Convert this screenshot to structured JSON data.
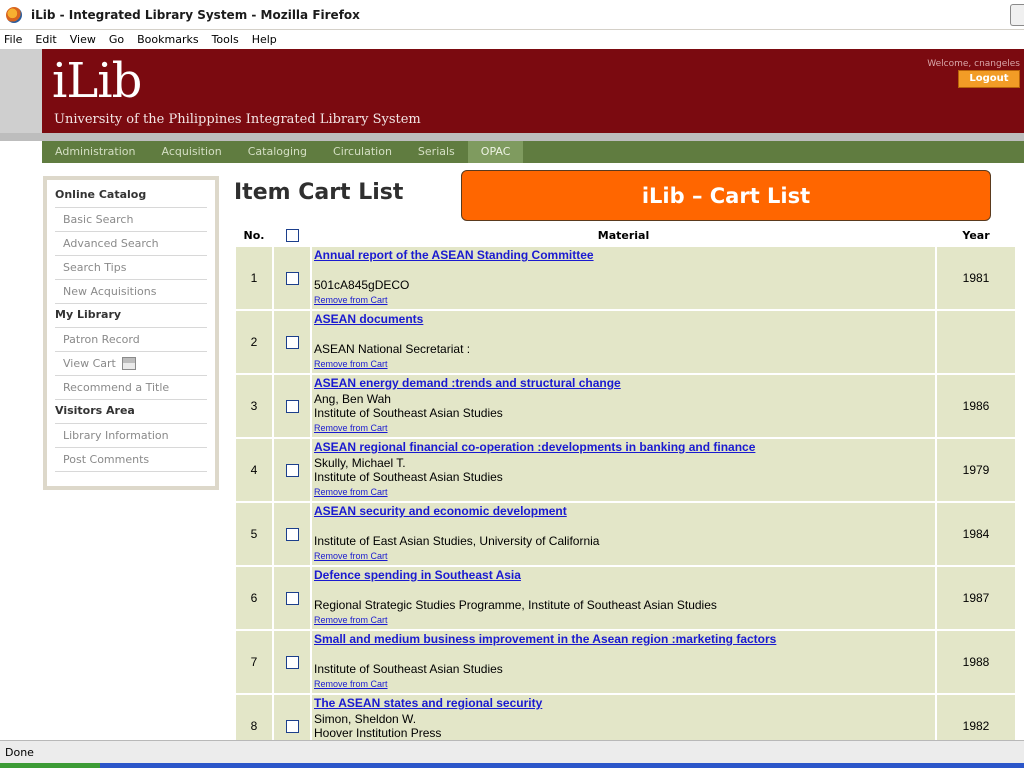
{
  "window": {
    "title": "iLib - Integrated Library System - Mozilla Firefox"
  },
  "menu": [
    "File",
    "Edit",
    "View",
    "Go",
    "Bookmarks",
    "Tools",
    "Help"
  ],
  "header": {
    "logo": "iLib",
    "subtitle": "University of the Philippines Integrated Library System",
    "welcome": "Welcome, cnangeles",
    "logout": "Logout"
  },
  "nav": [
    {
      "label": "Administration",
      "active": false
    },
    {
      "label": "Acquisition",
      "active": false
    },
    {
      "label": "Cataloging",
      "active": false
    },
    {
      "label": "Circulation",
      "active": false
    },
    {
      "label": "Serials",
      "active": false
    },
    {
      "label": "OPAC",
      "active": true
    }
  ],
  "sidebar": {
    "sections": [
      {
        "heading": "Online Catalog",
        "items": [
          "Basic Search",
          "Advanced Search",
          "Search Tips",
          "New Acquisitions"
        ]
      },
      {
        "heading": "My Library",
        "items": [
          "Patron Record",
          "View Cart",
          "Recommend a Title"
        ]
      },
      {
        "heading": "Visitors Area",
        "items": [
          "Library Information",
          "Post Comments"
        ]
      }
    ]
  },
  "main": {
    "title": "Item Cart List",
    "callout": "iLib – Cart List",
    "columns": {
      "no": "No.",
      "material": "Material",
      "year": "Year"
    },
    "remove_label": "Remove from Cart",
    "rows": [
      {
        "no": "1",
        "title": "Annual report of the ASEAN Standing Committee",
        "line1": "",
        "line2": "501cA845gDECO",
        "year": "1981"
      },
      {
        "no": "2",
        "title": "ASEAN documents",
        "line1": "",
        "line2": "ASEAN National Secretariat :",
        "year": ""
      },
      {
        "no": "3",
        "title": "ASEAN energy demand :trends and structural change",
        "line1": "Ang, Ben Wah",
        "line2": "Institute of Southeast Asian Studies",
        "year": "1986"
      },
      {
        "no": "4",
        "title": "ASEAN regional financial co-operation :developments in banking and finance",
        "line1": "Skully, Michael T.",
        "line2": "Institute of Southeast Asian Studies",
        "year": "1979"
      },
      {
        "no": "5",
        "title": "ASEAN security and economic development",
        "line1": "",
        "line2": "Institute of East Asian Studies, University of California",
        "year": "1984"
      },
      {
        "no": "6",
        "title": "Defence spending in Southeast Asia",
        "line1": "",
        "line2": "Regional Strategic Studies Programme, Institute of Southeast Asian Studies",
        "year": "1987"
      },
      {
        "no": "7",
        "title": "Small and medium business improvement in the Asean region :marketing factors",
        "line1": "",
        "line2": "Institute of Southeast Asian Studies",
        "year": "1988"
      },
      {
        "no": "8",
        "title": "The ASEAN states and regional security",
        "line1": "Simon, Sheldon W.",
        "line2": "Hoover Institution Press",
        "year": "1982"
      }
    ]
  },
  "status": "Done"
}
